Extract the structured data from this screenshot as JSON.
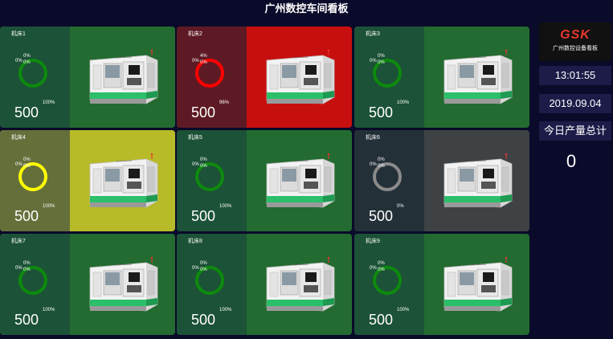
{
  "header": {
    "title": "广州数控车间看板"
  },
  "sidebar": {
    "logo_brand": "GSK",
    "logo_subtitle": "广州数控设备看板",
    "time": "13:01:55",
    "date": "2019.09.04",
    "total_label": "今日产量总计",
    "total_value": "0"
  },
  "colors": {
    "green_card": "#236b30",
    "green_left": "#1c5237",
    "red_card": "#c80f0f",
    "red_left": "#5e1a24",
    "yellow_card": "#b8bb28",
    "yellow_left": "#656f3a",
    "grey_card": "#3e4245",
    "grey_left": "#243038",
    "ring_green": "#0d8a0d",
    "ring_red": "#ff0000",
    "ring_yellow": "#ffff00",
    "ring_grey": "#8a8a8a"
  },
  "machines": [
    {
      "name": "机床1",
      "count": "500",
      "status": "green",
      "labels": [
        "0%",
        "0%",
        "0%",
        "100%"
      ]
    },
    {
      "name": "机床2",
      "count": "500",
      "status": "red",
      "labels": [
        "4%",
        "0%",
        "0%",
        "96%"
      ]
    },
    {
      "name": "机床3",
      "count": "500",
      "status": "green",
      "labels": [
        "0%",
        "0%",
        "0%",
        "100%"
      ]
    },
    {
      "name": "机床4",
      "count": "500",
      "status": "yellow",
      "labels": [
        "0%",
        "0%",
        "0%",
        "100%"
      ]
    },
    {
      "name": "机床5",
      "count": "500",
      "status": "green",
      "labels": [
        "0%",
        "0%",
        "0%",
        "100%"
      ]
    },
    {
      "name": "机床6",
      "count": "500",
      "status": "grey",
      "labels": [
        "0%",
        "0%",
        "0%",
        "0%"
      ]
    },
    {
      "name": "机床7",
      "count": "500",
      "status": "green",
      "labels": [
        "0%",
        "0%",
        "0%",
        "100%"
      ]
    },
    {
      "name": "机床8",
      "count": "500",
      "status": "green",
      "labels": [
        "0%",
        "0%",
        "0%",
        "100%"
      ]
    },
    {
      "name": "机床9",
      "count": "500",
      "status": "green",
      "labels": [
        "0%",
        "0%",
        "0%",
        "100%"
      ]
    }
  ]
}
